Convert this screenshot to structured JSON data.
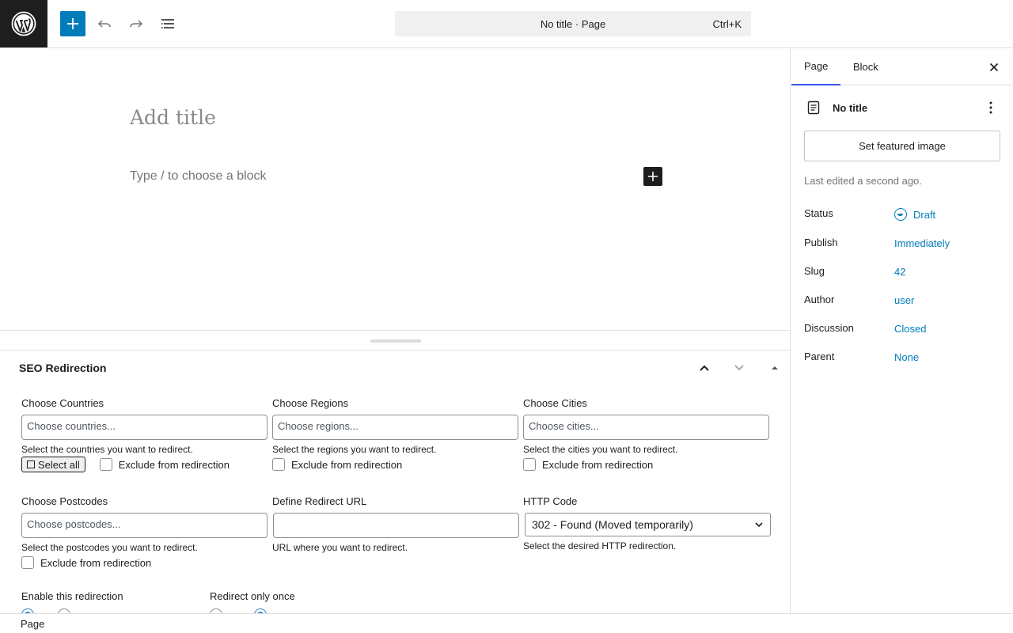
{
  "topbar": {
    "command_title": "No title · Page",
    "shortcut": "Ctrl+K",
    "icons": [
      "wordpress-logo",
      "plus-icon",
      "undo-icon",
      "redo-icon",
      "list-view-icon"
    ],
    "accent_color": "#007cba"
  },
  "editor": {
    "title_placeholder": "Add title",
    "block_placeholder": "Type / to choose a block"
  },
  "metabox": {
    "title": "SEO Redirection",
    "countries": {
      "label": "Choose Countries",
      "placeholder": "Choose countries...",
      "help": "Select the countries you want to redirect.",
      "select_all": "Select all",
      "exclude": "Exclude from redirection"
    },
    "regions": {
      "label": "Choose Regions",
      "placeholder": "Choose regions...",
      "help": "Select the regions you want to redirect.",
      "exclude": "Exclude from redirection"
    },
    "cities": {
      "label": "Choose Cities",
      "placeholder": "Choose cities...",
      "help": "Select the cities you want to redirect.",
      "exclude": "Exclude from redirection"
    },
    "postcodes": {
      "label": "Choose Postcodes",
      "placeholder": "Choose postcodes...",
      "help": "Select the postcodes you want to redirect.",
      "exclude": "Exclude from redirection"
    },
    "redirect_url": {
      "label": "Define Redirect URL",
      "value": "",
      "help": "URL where you want to redirect."
    },
    "http_code": {
      "label": "HTTP Code",
      "selected": "302 - Found (Moved temporarily)",
      "help": "Select the desired HTTP redirection."
    },
    "enable": {
      "label": "Enable this redirection",
      "selected": "enable"
    },
    "once": {
      "label": "Redirect only once",
      "selected": "disable"
    }
  },
  "footer": {
    "breadcrumb": "Page"
  },
  "sidebar": {
    "tabs": [
      {
        "label": "Page",
        "active": true
      },
      {
        "label": "Block",
        "active": false
      }
    ],
    "doc_title": "No title",
    "featured_button": "Set featured image",
    "last_edited": "Last edited a second ago.",
    "properties": [
      {
        "key": "Status",
        "value": "Draft"
      },
      {
        "key": "Publish",
        "value": "Immediately"
      },
      {
        "key": "Slug",
        "value": "42"
      },
      {
        "key": "Author",
        "value": "user"
      },
      {
        "key": "Discussion",
        "value": "Closed"
      },
      {
        "key": "Parent",
        "value": "None"
      }
    ],
    "tab_indicator_color": "#3858e9"
  }
}
